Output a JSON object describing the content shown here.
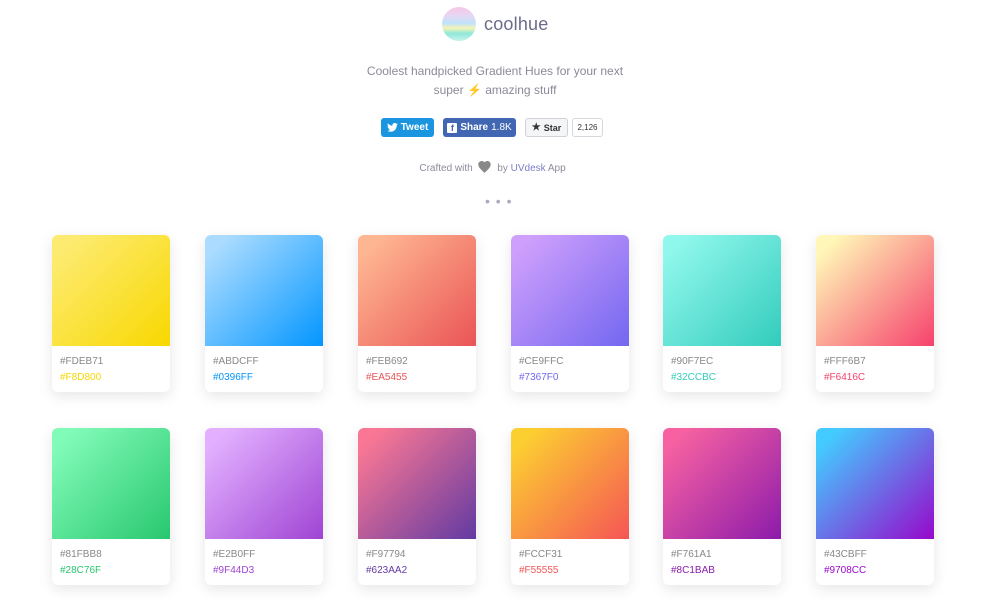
{
  "brand": {
    "name": "coolhue"
  },
  "tagline": {
    "line1": "Coolest handpicked Gradient Hues for your next",
    "line2_pre": "super",
    "line2_post": "amazing stuff",
    "bolt": "⚡"
  },
  "social": {
    "tweet": "Tweet",
    "share": "Share",
    "share_count": "1.8K",
    "star": "Star",
    "star_count": "2,126"
  },
  "crafted": {
    "pre": "Crafted with",
    "by": "by",
    "link": "UVdesk",
    "post": "App"
  },
  "more": "• • •",
  "gradients": [
    {
      "from": "#FDEB71",
      "to": "#F8D800"
    },
    {
      "from": "#ABDCFF",
      "to": "#0396FF"
    },
    {
      "from": "#FEB692",
      "to": "#EA5455"
    },
    {
      "from": "#CE9FFC",
      "to": "#7367F0"
    },
    {
      "from": "#90F7EC",
      "to": "#32CCBC"
    },
    {
      "from": "#FFF6B7",
      "to": "#F6416C"
    },
    {
      "from": "#81FBB8",
      "to": "#28C76F"
    },
    {
      "from": "#E2B0FF",
      "to": "#9F44D3"
    },
    {
      "from": "#F97794",
      "to": "#623AA2"
    },
    {
      "from": "#FCCF31",
      "to": "#F55555"
    },
    {
      "from": "#F761A1",
      "to": "#8C1BAB"
    },
    {
      "from": "#43CBFF",
      "to": "#9708CC"
    }
  ]
}
